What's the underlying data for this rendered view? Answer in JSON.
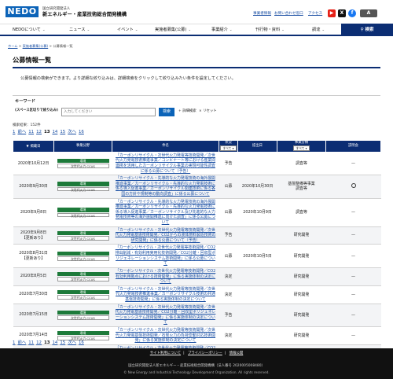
{
  "header": {
    "logo": "NEDO",
    "org_small": "国立研究開発法人",
    "org_main": "新エネルギー・産業技術総合開発機構",
    "util_links": [
      "事業者情報",
      "お問い合わせ窓口",
      "アクセス"
    ],
    "social": [
      {
        "icon": "youtube-icon",
        "glyph": "▶",
        "color": "#e62117"
      },
      {
        "icon": "x-icon",
        "glyph": "X",
        "color": "#111111"
      },
      {
        "icon": "facebook-icon",
        "glyph": "f",
        "color": "#1877f2"
      },
      {
        "icon": "language-icon",
        "glyph": "A",
        "color": "#555555"
      }
    ]
  },
  "nav": {
    "items": [
      "NEDOについて",
      "ニュース",
      "イベント",
      "実施者募集(公募)",
      "事業紹介",
      "刊行物・資料",
      "調達"
    ],
    "search_label": "検索"
  },
  "breadcrumb": [
    "ホーム",
    "実施者募集(公募)",
    "公募情報一覧"
  ],
  "page": {
    "title": "公募情報一覧",
    "intro": "公募情報の検索ができます。より詳細な絞り込みは、詳細検索をクリックして絞り込みたい条件を設定してください。"
  },
  "keyword": {
    "label": "キーワード",
    "sub": "(スペース区切りで絞り込み)",
    "placeholder": "入力してください",
    "search_button": "検索",
    "detail": "詳細検索",
    "reset": "リセット"
  },
  "result_count": "検索結果：152件",
  "pager": [
    {
      "label": "1",
      "type": "link"
    },
    {
      "label": "前へ",
      "type": "link"
    },
    {
      "label": "11",
      "type": "link"
    },
    {
      "label": "12",
      "type": "link"
    },
    {
      "label": "13",
      "type": "current"
    },
    {
      "label": "14",
      "type": "link"
    },
    {
      "label": "15",
      "type": "link"
    },
    {
      "label": "次へ",
      "type": "link"
    },
    {
      "label": "16",
      "type": "link"
    }
  ],
  "table": {
    "headers": {
      "date": "掲載日",
      "field": "事業分野",
      "name": "件名",
      "status": "状況",
      "deadline": "提出日",
      "type": "事業分類",
      "explain": "説明会"
    },
    "select_label": "すべて",
    "rows": [
      {
        "date": "2020年10月12日",
        "updated": "",
        "field1": "環境",
        "field2": "次世代火力 CCUS",
        "name": "「カーボンリサイクル・次世代火力発電等技術開発／次世代火力発電技術推進事業／コンビナート等における産業間連携を活用したカーボンリサイクル事業の実現可能性調査に係る公募について（予告）",
        "status": "予告",
        "deadline": "",
        "type": "調査等",
        "explain": "dash"
      },
      {
        "date": "2020年9月30日",
        "updated": "",
        "field1": "環境",
        "field2": "次世代火力 CCUS",
        "name": "「カーボンリサイクル・先導的な火力発電技術の海外展開推進事業／カーボンリサイクル・先導的な火力発電技術に係る導入促進事業／カーボンリサイクル関連技術に係る各国の方針や規制等の動向調査」に係る公募について",
        "status": "公募",
        "deadline": "2020年10月30日",
        "type": "基盤整備等事業\n調査等",
        "explain": "circle"
      },
      {
        "date": "2020年9月8日",
        "updated": "",
        "field1": "環境",
        "field2": "次世代火力 CCUS",
        "name": "「カーボンリサイクル・先導的な火力発電技術の海外展開推進事業／カーボンリサイクル・先導的な火力発電技術に係る導入促進事業／カーボンリサイクル及び先進的な火力発電技術等の海外展開推進に向けた調査」に係る公募について",
        "status": "公募",
        "deadline": "2020年10月9日",
        "type": "調査等",
        "explain": "dash"
      },
      {
        "date": "2020年9月8日",
        "updated": "【更新あり】",
        "field1": "環境",
        "field2": "次世代火力 CCUS",
        "name": "「カーボンリサイクル・次世代火力発電等技術開発／次世代火力発電基盤技術開発／CO2からの液体燃料製造技術の研究開発」に係る公募について（予告）",
        "status": "予告",
        "deadline": "",
        "type": "研究開発",
        "explain": "dash"
      },
      {
        "date": "2020年8月31日",
        "updated": "【更新あり】",
        "field1": "環境",
        "field2": "次世代火力 CCUS",
        "name": "「カーボンリサイクル・次世代火力発電等技術開発／CO2排出削減・有効利用実用化技術開発／CO2分離・回収型ポリジェネレーションシステム技術開発」に係る公募について",
        "status": "公募",
        "deadline": "2020年10月5日",
        "type": "研究開発",
        "explain": "dash"
      },
      {
        "date": "2020年8月5日",
        "updated": "",
        "field1": "環境",
        "field2": "次世代火力 CCUS",
        "name": "「カーボンリサイクル・次世代火力発電等技術開発／CO2有効利用拠点における技術開発」に係る実施体制の決定について",
        "status": "決定",
        "deadline": "",
        "type": "研究開発",
        "explain": "dash"
      },
      {
        "date": "2020年7月30日",
        "updated": "",
        "field1": "環境",
        "field2": "次世代火力 CCUS",
        "name": "「カーボンリサイクル・次世代火力発電等技術開発／次世代火力発電技術推進事業／カーボンリサイクル技術の共通基盤技術開発」に係る実施体制の決定について",
        "status": "決定",
        "deadline": "",
        "type": "研究開発",
        "explain": "dash"
      },
      {
        "date": "2020年7月15日",
        "updated": "",
        "field1": "環境",
        "field2": "次世代火力 CCUS",
        "name": "「カーボンリサイクル・次世代火力発電等技術開発／次世代火力発電基盤技術開発／CO2分離・回収型ポリジェネレーションシステム技術開発」に係る実施体制の決定について",
        "status": "予告",
        "deadline": "",
        "type": "研究開発",
        "explain": "dash"
      },
      {
        "date": "2020年7月14日",
        "updated": "",
        "field1": "環境",
        "field2": "次世代火力 CCUS",
        "name": "「カーボンリサイクル・次世代火力発電等技術開発／次世代火力発電基盤技術開発／石炭火力の負荷変動対応技術開発」に係る実施体制の決定について",
        "status": "決定",
        "deadline": "",
        "type": "研究開発",
        "explain": "dash"
      },
      {
        "date": "2020年7月14日",
        "updated": "",
        "field1": "環境",
        "field2": "次世代火力 CCUS",
        "name": "「カーボンリサイクル・次世代火力発電等技術開発／CO2排出削減・有効利用実用化技術開発／化学品へのCO2利用技術開発」に係る実施体制の決定について",
        "status": "決定",
        "deadline": "",
        "type": "研究開発",
        "explain": "dash"
      }
    ]
  },
  "footer": {
    "links": [
      "サイト利用について",
      "プライバシーポリシー",
      "情報公開"
    ],
    "org": "国立研究開発法人新エネルギー・産業技術総合開発機構（法人番号 2020005008480）",
    "copyright": "© New Energy and Industrial Technology Development Organization. All rights reserved."
  }
}
